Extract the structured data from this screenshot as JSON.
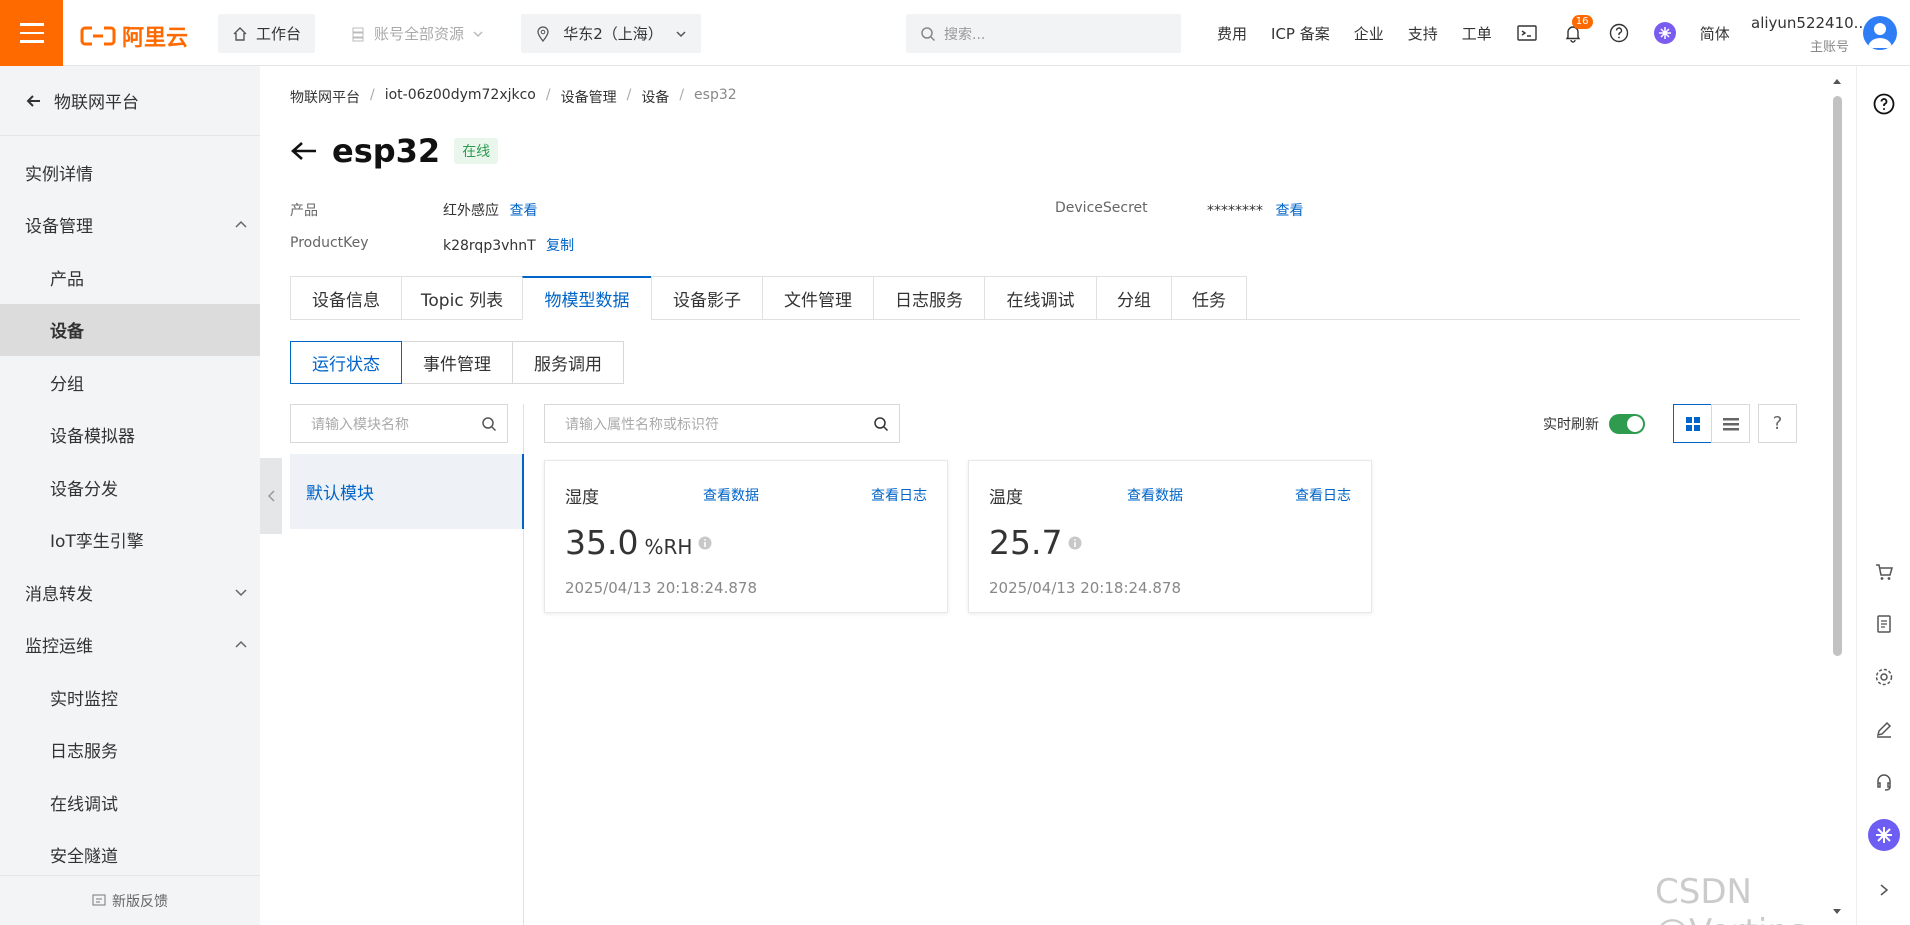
{
  "topbar": {
    "logo_text": "阿里云",
    "workbench": "工作台",
    "resources": "账号全部资源",
    "region": "华东2（上海）",
    "search_placeholder": "搜索...",
    "links": [
      "费用",
      "ICP 备案",
      "企业",
      "支持",
      "工单"
    ],
    "notification_count": "16",
    "lang": "简体",
    "account_name": "aliyun522410...",
    "account_role": "主账号"
  },
  "sidebar": {
    "back_label": "物联网平台",
    "items": [
      {
        "label": "实例详情"
      },
      {
        "label": "设备管理"
      },
      {
        "label": "产品"
      },
      {
        "label": "设备"
      },
      {
        "label": "分组"
      },
      {
        "label": "设备模拟器"
      },
      {
        "label": "设备分发"
      },
      {
        "label": "IoT孪生引擎"
      },
      {
        "label": "消息转发"
      },
      {
        "label": "监控运维"
      },
      {
        "label": "实时监控"
      },
      {
        "label": "日志服务"
      },
      {
        "label": "在线调试"
      },
      {
        "label": "安全隧道"
      }
    ],
    "feedback": "新版反馈"
  },
  "breadcrumb": [
    "物联网平台",
    "iot-06z00dym72xjkco",
    "设备管理",
    "设备",
    "esp32"
  ],
  "device": {
    "name": "esp32",
    "status": "在线",
    "product_label": "产品",
    "product_value": "红外感应",
    "productkey_label": "ProductKey",
    "productkey_value": "k28rqp3vhnT",
    "secret_label": "DeviceSecret",
    "secret_value": "********",
    "view": "查看",
    "copy": "复制"
  },
  "tabs": [
    "设备信息",
    "Topic 列表",
    "物模型数据",
    "设备影子",
    "文件管理",
    "日志服务",
    "在线调试",
    "分组",
    "任务"
  ],
  "subtabs": [
    "运行状态",
    "事件管理",
    "服务调用"
  ],
  "module_search_placeholder": "请输入模块名称",
  "module_default": "默认模块",
  "prop_search_placeholder": "请输入属性名称或标识符",
  "realtime_label": "实时刷新",
  "help_label": "?",
  "cards": [
    {
      "name": "湿度",
      "view_data": "查看数据",
      "view_log": "查看日志",
      "value": "35.0",
      "unit": "%RH",
      "time": "2025/04/13 20:18:24.878"
    },
    {
      "name": "温度",
      "view_data": "查看数据",
      "view_log": "查看日志",
      "value": "25.7",
      "unit": "",
      "time": "2025/04/13 20:18:24.878"
    }
  ],
  "watermark": "CSDN @Vertins",
  "colors": {
    "brand": "#ff6a00",
    "link": "#0064c8",
    "online": "#2f9b4f"
  }
}
